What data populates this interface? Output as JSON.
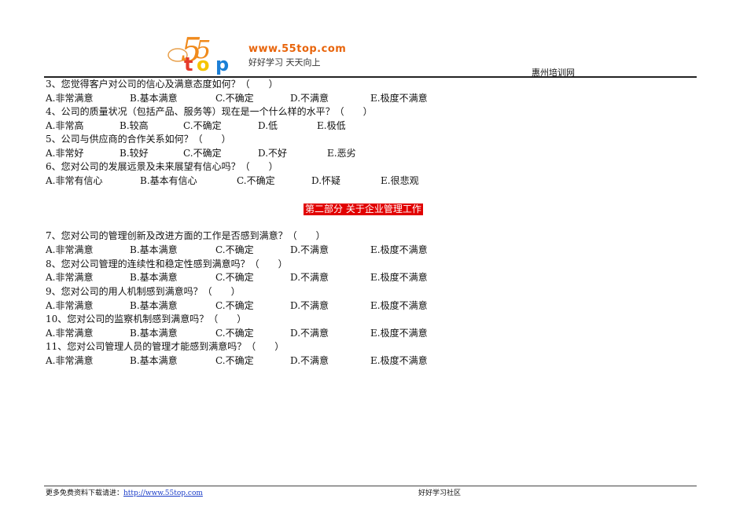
{
  "header": {
    "logo_text": "55top",
    "logo_url": "www.55top.com",
    "logo_slogan": "好好学习  天天向上",
    "site_name": "惠州培训网",
    "brand_colors": {
      "orange": "#e8650c",
      "red": "#e53a2a",
      "yellow": "#f5c400",
      "blue": "#1c7fd6"
    }
  },
  "questions_part1": [
    {
      "text": "3、您觉得客户对公司的信心及满意态度如何？（　　）",
      "options": [
        "A.非常满意",
        "B.基本满意",
        "C.不确定",
        "D.不满意",
        "E.极度不满意"
      ]
    },
    {
      "text": "4、公司的质量状况（包括产品、服务等）现在是一个什么样的水平？（　　）",
      "options": [
        "A.非常高",
        "B.较高",
        "C.不确定",
        "D.低",
        "E.极低"
      ]
    },
    {
      "text": "5、公司与供应商的合作关系如何？（　　）",
      "options": [
        "A.非常好",
        "B.较好",
        "C.不确定",
        "D.不好",
        "E.恶劣"
      ]
    },
    {
      "text": "6、您对公司的发展远景及未来展望有信心吗？（　　）",
      "options": [
        "A.非常有信心",
        "B.基本有信心",
        "C.不确定",
        "D.怀疑",
        "E.很悲观"
      ]
    }
  ],
  "section_title": "第二部分  关于企业管理工作",
  "section_color": "#e10000",
  "questions_part2": [
    {
      "text": "7、您对公司的管理创新及改进方面的工作是否感到满意？（　　）",
      "options": [
        "A.非常满意",
        "B.基本满意",
        "C.不确定",
        "D.不满意",
        "E.极度不满意"
      ]
    },
    {
      "text": "8、您对公司管理的连续性和稳定性感到满意吗？（　　）",
      "options": [
        "A.非常满意",
        "B.基本满意",
        "C.不确定",
        "D.不满意",
        "E.极度不满意"
      ]
    },
    {
      "text": "9、您对公司的用人机制感到满意吗？（　　）",
      "options": [
        "A.非常满意",
        "B.基本满意",
        "C.不确定",
        "D.不满意",
        "E.极度不满意"
      ]
    },
    {
      "text": "10、您对公司的监察机制感到满意吗？（　　）",
      "options": [
        "A.非常满意",
        "B.基本满意",
        "C.不确定",
        "D.不满意",
        "E.极度不满意"
      ]
    },
    {
      "text": "11、您对公司管理人员的管理才能感到满意吗？（　　）",
      "options": [
        "A.非常满意",
        "B.基本满意",
        "C.不确定",
        "D.不满意",
        "E.极度不满意"
      ]
    }
  ],
  "footer": {
    "download_label": "更多免费资料下载请进：",
    "link": "http://www.55top.com",
    "community": "好好学习社区"
  }
}
